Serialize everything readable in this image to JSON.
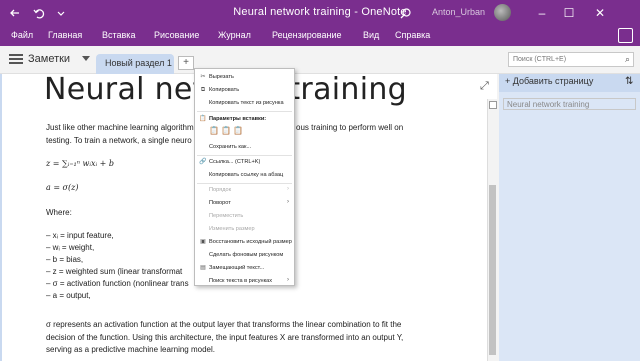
{
  "window": {
    "title": "Neural network training - OneNote",
    "user_name": "Anton_Urban",
    "back_icon": "back-arrow-icon",
    "undo_icon": "undo-icon",
    "dropdown_icon": "chevron-down-icon",
    "search_icon": "search-icon",
    "minimize": "–",
    "maximize": "☐",
    "close": "✕",
    "colors": {
      "title_bar": "#7a2e8e",
      "section_tab": "#c9d9f0",
      "page_pane": "#dbe6f6"
    }
  },
  "menu": {
    "items": [
      "Файл",
      "Главная",
      "Вставка",
      "Рисование",
      "Журнал",
      "Рецензирование",
      "Вид",
      "Справка"
    ]
  },
  "notebook": {
    "name": "Заметки",
    "section_tab": "Новый раздел 1",
    "add_section": "+",
    "search_placeholder": "Поиск (CTRL+E)"
  },
  "page_list": {
    "add_page": "Добавить страницу",
    "pages": [
      "Neural network training"
    ]
  },
  "page": {
    "title": "Neural network training",
    "intro_line1": "Just like other machine learning algorithm",
    "intro_line1_tail": "ous training to perform well on",
    "intro_line2": "testing. To train a network, a single neuro",
    "formula1": "z = ∑ᵢ₌₁ⁿ wᵢxᵢ + b",
    "formula2": "a = σ(z)",
    "where": "Where:",
    "bullets": [
      "–    xᵢ = input feature,",
      "–    wᵢ = weight,",
      "–    b = bias,",
      "–    z = weighted sum (linear transformat",
      "–    σ = activation function (nonlinear trans",
      "–    a = output,"
    ],
    "para_line1": "σ represents an activation function at the output layer that transforms the linear combination to fit the",
    "para_line2": "decision of the function. Using this architecture, the input features X are transformed into an output Y,",
    "para_line3": "serving as a predictive machine learning model."
  },
  "context_menu": {
    "items": [
      {
        "label": "Вырезать",
        "icon": "scissors-icon",
        "enabled": true
      },
      {
        "label": "Копировать",
        "icon": "copy-icon",
        "enabled": true
      },
      {
        "label": "Копировать текст из рисунка",
        "icon": "",
        "enabled": true
      },
      {
        "label": "Параметры вставки:",
        "icon": "paste-icon",
        "enabled": true,
        "bold": true
      },
      {
        "label": "Сохранить как...",
        "icon": "",
        "enabled": true
      },
      {
        "label": "Ссылка...   (CTRL+K)",
        "icon": "link-icon",
        "enabled": true
      },
      {
        "label": "Копировать ссылку на абзац",
        "icon": "",
        "enabled": true
      },
      {
        "label": "Порядок",
        "icon": "",
        "enabled": false,
        "submenu": true
      },
      {
        "label": "Поворот",
        "icon": "",
        "enabled": true,
        "submenu": true
      },
      {
        "label": "Переместить",
        "icon": "",
        "enabled": false
      },
      {
        "label": "Изменить размер",
        "icon": "",
        "enabled": false
      },
      {
        "label": "Восстановить исходный размер",
        "icon": "restore-size-icon",
        "enabled": true
      },
      {
        "label": "Сделать фоновым рисунком",
        "icon": "",
        "enabled": true
      },
      {
        "label": "Замещающий текст...",
        "icon": "alt-text-icon",
        "enabled": true
      },
      {
        "label": "Поиск текста в рисунках",
        "icon": "",
        "enabled": true,
        "submenu": true
      }
    ]
  }
}
